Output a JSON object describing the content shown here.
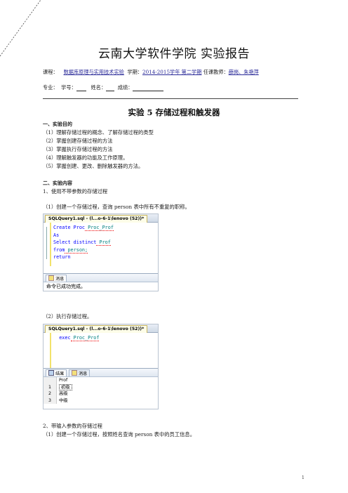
{
  "title": "云南大学软件学院  实验报告",
  "meta1": {
    "course_label": "课程：",
    "course": "数据库原理与实用技术实验",
    "term_label": "学期：",
    "term": "2014-2015学年 第二学期",
    "teacher_label": "任课教师：",
    "teacher": "薛岗、朱艳萍"
  },
  "meta2": {
    "major_label": "专业：",
    "id_label": "学号：",
    "name_label": "姓名：",
    "score_label": "成绩："
  },
  "heading": "实验 5    存储过程和触发器",
  "section1": {
    "title": "一、实验目的",
    "items": [
      "（1）理解存储过程的概念、了解存储过程的类型",
      "（2）掌握创建存储过程的方法",
      "（3）掌握执行存储过程的方法",
      "（4）理解触发器的功能及工作原理。",
      "（5）掌握创建、更改、删除触发器的方法。"
    ]
  },
  "section2": {
    "title": "二、实验内容",
    "sub1": "1、使用不带参数的存储过程",
    "step1": "（1）创建一个存储过程，查询 person 表中所有不重复的职称。",
    "step2": "（2）执行存储过程。",
    "sub2": "2、带输入参数的存储过程",
    "step3": "（1）创建一个存储过程，按照姓名查询 person 表中的员工信息。"
  },
  "shot1": {
    "tab": "SQLQuery1.sql - (l...o-6-1\\lenovo (52))*",
    "lines": [
      {
        "kw": "Create Proc",
        "id": " Proc_Prof"
      },
      {
        "kw": "As",
        "id": ""
      },
      {
        "kw": "Select distinct",
        "id": " Prof"
      },
      {
        "kw": "from",
        "id": " person;"
      },
      {
        "kw": "return",
        "id": ""
      }
    ],
    "msg_tab": "消息",
    "msg": "命令已成功完成。"
  },
  "shot2": {
    "tab": "SQLQuery1.sql - (l...o-6-1\\lenovo (52))*",
    "line": {
      "kw": "exec",
      "id": " Proc_Prof"
    },
    "tab_results": "结果",
    "tab_messages": "消息",
    "col": "Prof",
    "rows": [
      {
        "n": "1",
        "v": "初级"
      },
      {
        "n": "2",
        "v": "高级"
      },
      {
        "n": "3",
        "v": "中级"
      }
    ]
  },
  "page_number": "1"
}
